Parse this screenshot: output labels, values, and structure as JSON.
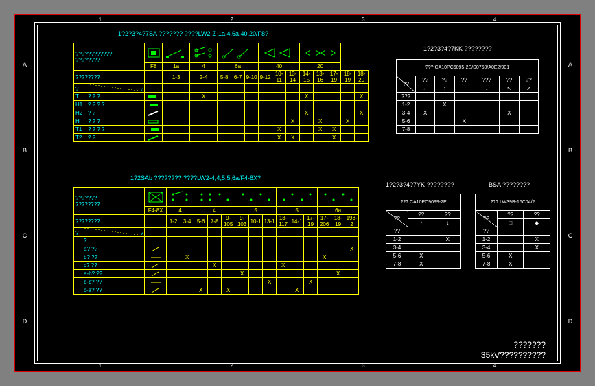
{
  "ruler_cols": [
    "1",
    "2",
    "3",
    "4"
  ],
  "ruler_rows": [
    "A",
    "B",
    "C",
    "D"
  ],
  "titles": {
    "t7SA": "1?2?3?4?7SA ???????   ????LW2-Z-1a.4.6a.40.20/F8?",
    "t2SAb": "1?2SAb ????????   ????LW2-4,4,5,5,6a/F4-8X?",
    "t7KK": "1?2?3?4?7KK ????????",
    "t7YK": "1?2?3?4?7YK ????????",
    "tBSA": "BSA ????????"
  },
  "bottom": {
    "line1": "???????",
    "line2": "35kV??????????"
  },
  "t7SA": {
    "headerSmall1": "????????????",
    "headerSmall2": "????????",
    "headerLabel": "????????",
    "cols": [
      "F8",
      "1a",
      "4",
      "6a",
      "40",
      "20"
    ],
    "subcols": [
      "1-3",
      "2-4",
      "5-8",
      "6-7",
      "9-10",
      "9-12",
      "10-11",
      "13-14",
      "14-15",
      "13-16",
      "17-19",
      "18-19",
      "18-20"
    ],
    "rows": [
      {
        "lbl": "T",
        "lbl2": "? ? ?",
        "vals": [
          "",
          "X",
          "",
          "",
          "",
          "",
          "",
          "",
          "X",
          "",
          "",
          "",
          "X"
        ],
        "icon": "sw-h-left"
      },
      {
        "lbl": "H1",
        "lbl2": "? ? ? ?",
        "vals": [
          "",
          "",
          "",
          "",
          "",
          "",
          "",
          "",
          "",
          "",
          "",
          "",
          ""
        ],
        "icon": "sw-dash"
      },
      {
        "lbl": "H2",
        "lbl2": "?      ?",
        "vals": [
          "",
          "",
          "",
          "",
          "",
          "",
          "",
          "",
          "X",
          "",
          "",
          "",
          "X"
        ],
        "icon": "sw-diag"
      },
      {
        "lbl": "H",
        "lbl2": "?    ?  ?",
        "vals": [
          "",
          "",
          "",
          "",
          "",
          "",
          "",
          "X",
          "",
          "X",
          "",
          "X",
          ""
        ],
        "icon": "sw-hb"
      },
      {
        "lbl": "T1",
        "lbl2": "? ? ? ?",
        "vals": [
          "",
          "",
          "",
          "",
          "",
          "",
          "X",
          "",
          "",
          "X",
          "X",
          "",
          ""
        ],
        "icon": "sw-h-right"
      },
      {
        "lbl": "T2",
        "lbl2": "?    ?",
        "vals": [
          "",
          "",
          "",
          "",
          "",
          "",
          "X",
          "X",
          "",
          "",
          "X",
          "",
          ""
        ],
        "icon": "sw-diag2"
      }
    ],
    "icons": [
      "sym-plug",
      "sym-switch-a",
      "sym-switch-set",
      "sym-contact-pair",
      "sym-relay",
      "sym-relay2"
    ]
  },
  "t2SAb": {
    "headerSmall1": "???????",
    "headerSmall2": "????????",
    "headerLabel": "????????",
    "cols": [
      "F4-8X",
      "4",
      "4",
      "5",
      "5",
      "6a"
    ],
    "subcols": [
      "1-2",
      "3-4",
      "5-6",
      "7-8",
      "9-105",
      "9-103",
      "10-1",
      "13-1",
      "13-117",
      "14-1",
      "17-19",
      "17-206",
      "18-19",
      "198-2"
    ],
    "rows": [
      {
        "lbl": "?",
        "lbl2": "",
        "vals": [
          "",
          "",
          "",
          "",
          "",
          "",
          "",
          "",
          "",
          "",
          "",
          "",
          "",
          ""
        ],
        "icon": ""
      },
      {
        "lbl": "",
        "lbl2": "a? ??",
        "vals": [
          "",
          "",
          "",
          "",
          "",
          "",
          "",
          "",
          "",
          "",
          "",
          "",
          "",
          "X"
        ],
        "icon": "slash"
      },
      {
        "lbl": "",
        "lbl2": "b? ??",
        "vals": [
          "",
          "X",
          "",
          "",
          "",
          "",
          "",
          "",
          "",
          "",
          "",
          "X",
          "",
          ""
        ],
        "icon": "bar"
      },
      {
        "lbl": "",
        "lbl2": "c? ??",
        "vals": [
          "",
          "",
          "",
          "X",
          "",
          "",
          "",
          "",
          "X",
          "",
          "",
          "",
          "",
          ""
        ],
        "icon": "slash"
      },
      {
        "lbl": "",
        "lbl2": "a-b? ??",
        "vals": [
          "",
          "",
          "",
          "",
          "",
          "X",
          "",
          "",
          "",
          "",
          "",
          "",
          "X",
          ""
        ],
        "icon": "slash"
      },
      {
        "lbl": "",
        "lbl2": "b-c? ??",
        "vals": [
          "",
          "",
          "",
          "",
          "",
          "",
          "",
          "X",
          "",
          "",
          "X",
          "",
          "",
          ""
        ],
        "icon": "bar"
      },
      {
        "lbl": "",
        "lbl2": "c-a? ??",
        "vals": [
          "",
          "",
          "X",
          "",
          "X",
          "",
          "",
          "",
          "",
          "X",
          "",
          "",
          "",
          ""
        ],
        "icon": "slash"
      }
    ],
    "icons": [
      "sym-box",
      "sym-dots",
      "sym-dots",
      "sym-dots",
      "sym-dots",
      "sym-dots"
    ]
  },
  "t7KK": {
    "header": "??? CA10PC6095-2E/S0760/A0E2/901",
    "colhdrs": [
      "??",
      "??",
      "??",
      "??",
      "???",
      "??",
      "??"
    ],
    "arrows": [
      "",
      "←",
      "↑",
      "→",
      "↓",
      "↖",
      "↗"
    ],
    "rows": [
      {
        "lbl": "???",
        "vals": [
          "",
          "",
          "",
          "",
          "",
          ""
        ]
      },
      {
        "lbl": "1-2",
        "vals": [
          "",
          "X",
          "",
          "",
          "",
          ""
        ]
      },
      {
        "lbl": "3-4",
        "vals": [
          "X",
          "",
          "",
          "",
          "X",
          ""
        ]
      },
      {
        "lbl": "5-6",
        "vals": [
          "",
          "",
          "X",
          "",
          "",
          ""
        ]
      },
      {
        "lbl": "7-8",
        "vals": [
          "",
          "",
          "",
          "",
          "",
          ""
        ]
      }
    ]
  },
  "t7YK": {
    "header": "??? CA10PC9099-2E",
    "colhdrs": [
      "??",
      "??"
    ],
    "arrows": [
      "↑",
      "↓"
    ],
    "rows": [
      {
        "lbl": "??",
        "vals": [
          "",
          ""
        ]
      },
      {
        "lbl": "1-2",
        "vals": [
          "",
          "X"
        ]
      },
      {
        "lbl": "3-4",
        "vals": [
          "",
          ""
        ]
      },
      {
        "lbl": "5-6",
        "vals": [
          "X",
          ""
        ]
      },
      {
        "lbl": "7-8",
        "vals": [
          "X",
          ""
        ]
      }
    ]
  },
  "tBSA": {
    "header": "??? LW39B-16C04/2",
    "colhdrs": [
      "??",
      "??"
    ],
    "icons": [
      "□",
      "◆"
    ],
    "rows": [
      {
        "lbl": "??",
        "vals": [
          "",
          ""
        ]
      },
      {
        "lbl": "1-2",
        "vals": [
          "",
          "X"
        ]
      },
      {
        "lbl": "3-4",
        "vals": [
          "",
          "X"
        ]
      },
      {
        "lbl": "5-6",
        "vals": [
          "X",
          ""
        ]
      },
      {
        "lbl": "7-8",
        "vals": [
          "X",
          ""
        ]
      }
    ]
  }
}
